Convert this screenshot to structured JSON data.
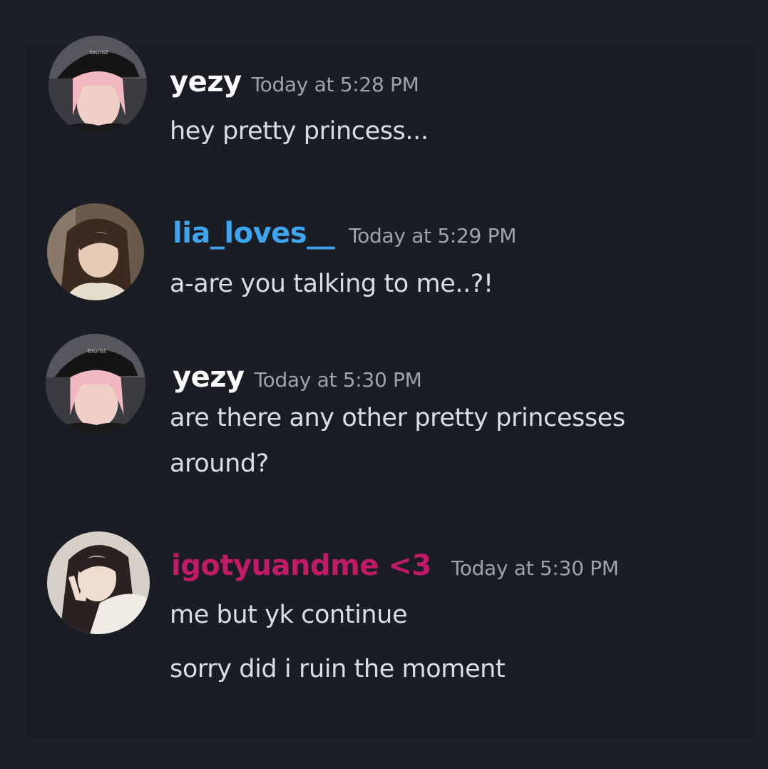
{
  "colors": {
    "background": "#1e2028",
    "message_text": "#dcdde1",
    "timestamp": "#a0a3ab"
  },
  "messages": [
    {
      "username": "yezy",
      "username_color": "#ffffff",
      "timestamp": "Today at 5:28 PM",
      "avatar": "pink-hair-bucket-hat-avatar",
      "lines": [
        "hey pretty princess..."
      ]
    },
    {
      "username": "lia_loves__",
      "username_color": "#3ea6ef",
      "timestamp": "Today at 5:29 PM",
      "avatar": "brown-braided-hair-avatar",
      "lines": [
        "a-are you talking to me..?!"
      ]
    },
    {
      "username": "yezy",
      "username_color": "#ffffff",
      "timestamp": "Today at 5:30 PM",
      "avatar": "pink-hair-bucket-hat-avatar",
      "lines": [
        "are there any other pretty princesses",
        "around?"
      ]
    },
    {
      "username": "igotyuandme <3",
      "username_color": "#c21a66",
      "timestamp": "Today at 5:30 PM",
      "avatar": "long-dark-hair-peace-sign-avatar",
      "lines": [
        "me but yk continue",
        "sorry did i ruin the moment"
      ]
    }
  ]
}
